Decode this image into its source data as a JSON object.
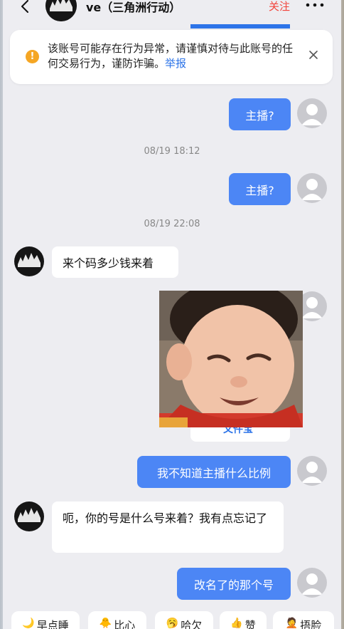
{
  "header": {
    "title": "ve（三角洲行动）",
    "follow_label": "关注"
  },
  "banner": {
    "text": "该账号可能存在行为异常，请谨慎对待与此账号的任何交易行为，谨防诈骗。",
    "report_label": "举报"
  },
  "messages": [
    {
      "side": "out",
      "text": "主播?"
    },
    {
      "timestamp": "08/19 18:12"
    },
    {
      "side": "out",
      "text": "主播?"
    },
    {
      "timestamp": "08/19 22:08"
    },
    {
      "side": "in",
      "text": "来个码多少钱来着"
    },
    {
      "side": "out",
      "type": "sticker",
      "card_label": "文件宝"
    },
    {
      "side": "out",
      "text": "我不知道主播什么比例"
    },
    {
      "side": "in",
      "text": "呃，你的号是什么号来着？我有点忘记了"
    },
    {
      "side": "out",
      "text": "改名了的那个号"
    }
  ],
  "quick_replies": [
    {
      "emoji": "🌙",
      "label": "早点睡"
    },
    {
      "emoji": "🐥",
      "label": "比心"
    },
    {
      "emoji": "🥱",
      "label": "哈欠"
    },
    {
      "emoji": "👍",
      "label": "赞"
    },
    {
      "emoji": "🤦",
      "label": "捂脸"
    }
  ],
  "colors": {
    "accent_blue": "#4c86f5",
    "follow_red": "#f2433b",
    "warning_orange": "#f5a623"
  }
}
